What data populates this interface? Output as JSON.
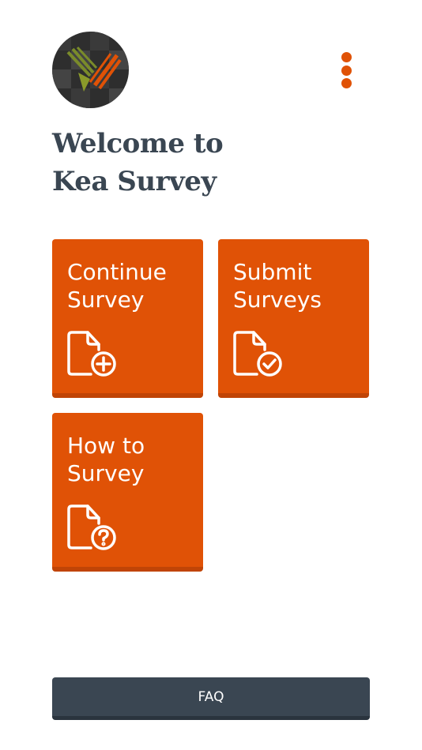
{
  "app": {
    "logo_icon": "kea-survey-logo-icon"
  },
  "header": {
    "menu_icon": "more-vertical-icon",
    "title_line1": "Welcome to",
    "title_line2": "Kea Survey"
  },
  "tiles": [
    {
      "label": "Continue\nSurvey",
      "icon": "file-plus-icon"
    },
    {
      "label": "Submit\nSurveys",
      "icon": "file-check-icon"
    },
    {
      "label": "How to\nSurvey",
      "icon": "file-question-icon"
    }
  ],
  "footer": {
    "faq_label": "FAQ"
  },
  "colors": {
    "accent": "#e05206",
    "accent_dark": "#c04406",
    "heading": "#3a4652",
    "faq_bg": "#3a4652",
    "background": "#ffffff"
  }
}
